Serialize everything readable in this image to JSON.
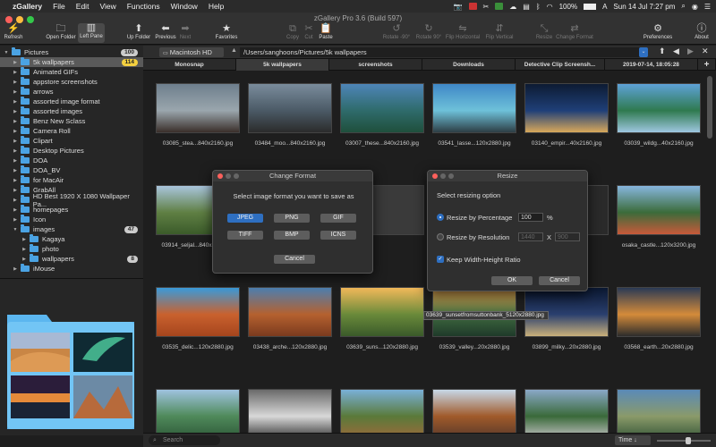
{
  "menubar": {
    "app": "zGallery",
    "items": [
      "File",
      "Edit",
      "View",
      "Functions",
      "Window",
      "Help"
    ],
    "battery": "100%",
    "clock": "Sun 14 Jul  7:27 pm"
  },
  "window": {
    "title": "zGallery Pro 3.6 (Build 597)"
  },
  "toolbar": {
    "refresh": "Refresh",
    "open_folder": "Open Folder",
    "left_pane": "Left Pane",
    "up_folder": "Up Folder",
    "previous": "Previous",
    "next": "Next",
    "favorites": "Favorites",
    "copy": "Copy",
    "cut": "Cut",
    "paste": "Paste",
    "rotate_left": "Rotate -90°",
    "rotate_right": "Rotate 90°",
    "flip_h": "Flip Horizontal",
    "flip_v": "Flip Vertical",
    "resize": "Resize",
    "change_format": "Change Format",
    "preferences": "Preferences",
    "about": "About"
  },
  "sidebar": {
    "items": [
      {
        "label": "Pictures",
        "badge": "100",
        "level": 0,
        "open": true
      },
      {
        "label": "5k wallpapers",
        "badge": "114",
        "level": 1,
        "selected": true
      },
      {
        "label": "Animated GIFs",
        "level": 1
      },
      {
        "label": "appstore screenshots",
        "level": 1
      },
      {
        "label": "arrows",
        "level": 1
      },
      {
        "label": "assorted image format",
        "level": 1
      },
      {
        "label": "assorted images",
        "level": 1
      },
      {
        "label": "Benz New Sclass",
        "level": 1
      },
      {
        "label": "Camera Roll",
        "level": 1
      },
      {
        "label": "Clipart",
        "level": 1
      },
      {
        "label": "Desktop Pictures",
        "level": 1
      },
      {
        "label": "DOA",
        "level": 1
      },
      {
        "label": "DOA_BV",
        "level": 1
      },
      {
        "label": "for MacAir",
        "level": 1
      },
      {
        "label": "GrabAll",
        "level": 1
      },
      {
        "label": "HD Best 1920 X 1080 Wallpaper Pa...",
        "level": 1
      },
      {
        "label": "homepages",
        "level": 1
      },
      {
        "label": "Icon",
        "level": 1
      },
      {
        "label": "images",
        "badge": "47",
        "level": 1,
        "open": true
      },
      {
        "label": "Kagaya",
        "level": 2
      },
      {
        "label": "photo",
        "level": 2
      },
      {
        "label": "wallpapers",
        "badge": "8",
        "level": 2
      },
      {
        "label": "iMouse",
        "level": 1
      }
    ]
  },
  "pathbar": {
    "volume": "Macintosh HD",
    "path": "/Users/sanghoons/Pictures/5k wallpapers"
  },
  "tabs": [
    "Monosnap",
    "5k wallpapers",
    "screenshots",
    "Downloads",
    "Detective Clip Screensh...",
    "2019-07-14, 18:05:28"
  ],
  "grid": {
    "captions": [
      "03085_stea...840x2160.jpg",
      "03484_moo...840x2160.jpg",
      "03007_these...840x2160.jpg",
      "03541_lasse...120x2880.jpg",
      "03140_empir...40x2160.jpg",
      "03039_wildg...40x2160.jpg",
      "03914_seljal...840x2160.jpg",
      "",
      "",
      "...40x2160.jpg",
      "",
      "osaka_castle...120x3200.jpg",
      "03535_delic...120x2880.jpg",
      "03438_arche...120x2880.jpg",
      "03639_suns...120x2880.jpg",
      "03539_valley...20x2880.jpg",
      "03899_milky...20x2880.jpg",
      "03568_earth...20x2880.jpg"
    ],
    "tooltip": "03639_sunsetfromsuttonbank_5120x2880.jpg"
  },
  "dialog_format": {
    "title": "Change Format",
    "prompt": "Select image format you want to save as",
    "formats": [
      "JPEG",
      "PNG",
      "GIF",
      "TIFF",
      "BMP",
      "ICNS"
    ],
    "selected": "JPEG",
    "cancel": "Cancel"
  },
  "dialog_resize": {
    "title": "Resize",
    "prompt": "Select resizing option",
    "by_percent": "Resize by Percentage",
    "percent_value": "100",
    "percent_unit": "%",
    "by_resolution": "Resize by Resolution",
    "width": "1440",
    "x": "X",
    "height": "900",
    "keep_ratio": "Keep Width-Height Ratio",
    "ok": "OK",
    "cancel": "Cancel"
  },
  "bottombar": {
    "search_placeholder": "Search",
    "sort": "Time ↓"
  }
}
